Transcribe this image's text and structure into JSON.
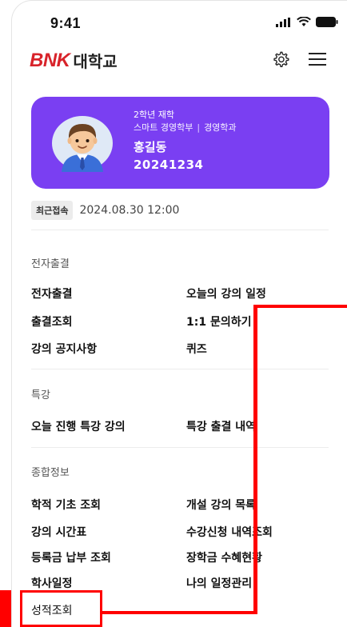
{
  "status": {
    "time": "9:41"
  },
  "header": {
    "brand": "BNK",
    "title": "대학교",
    "settings_icon": "gear-icon",
    "menu_icon": "hamburger-menu-icon"
  },
  "profile": {
    "grade": "2학년 재학",
    "school": "스마트 경영학부",
    "separator": "|",
    "major": "경영학과",
    "name": "홍길동",
    "student_id": "20241234",
    "card_color": "#7a3ff2"
  },
  "last_access": {
    "badge": "최근접속",
    "datetime": "2024.08.30  12:00"
  },
  "sections": {
    "attendance": {
      "title": "전자출결",
      "items": [
        "전자출결",
        "오늘의 강의 일정",
        "출결조회",
        "1:1 문의하기",
        "강의 공지사항",
        "퀴즈"
      ]
    },
    "special": {
      "title": "특강",
      "items": [
        "오늘 진행 특강 강의",
        "특강 출결 내역"
      ]
    },
    "general": {
      "title": "종합정보",
      "items": [
        "학적 기초 조회",
        "개설 강의 목록",
        "강의 시간표",
        "수강신청 내역조회",
        "등록금 납부 조회",
        "장학금 수혜현황",
        "학사일정",
        "나의 일정관리",
        "성적조회"
      ]
    }
  },
  "annotation_color": "#ff0000"
}
